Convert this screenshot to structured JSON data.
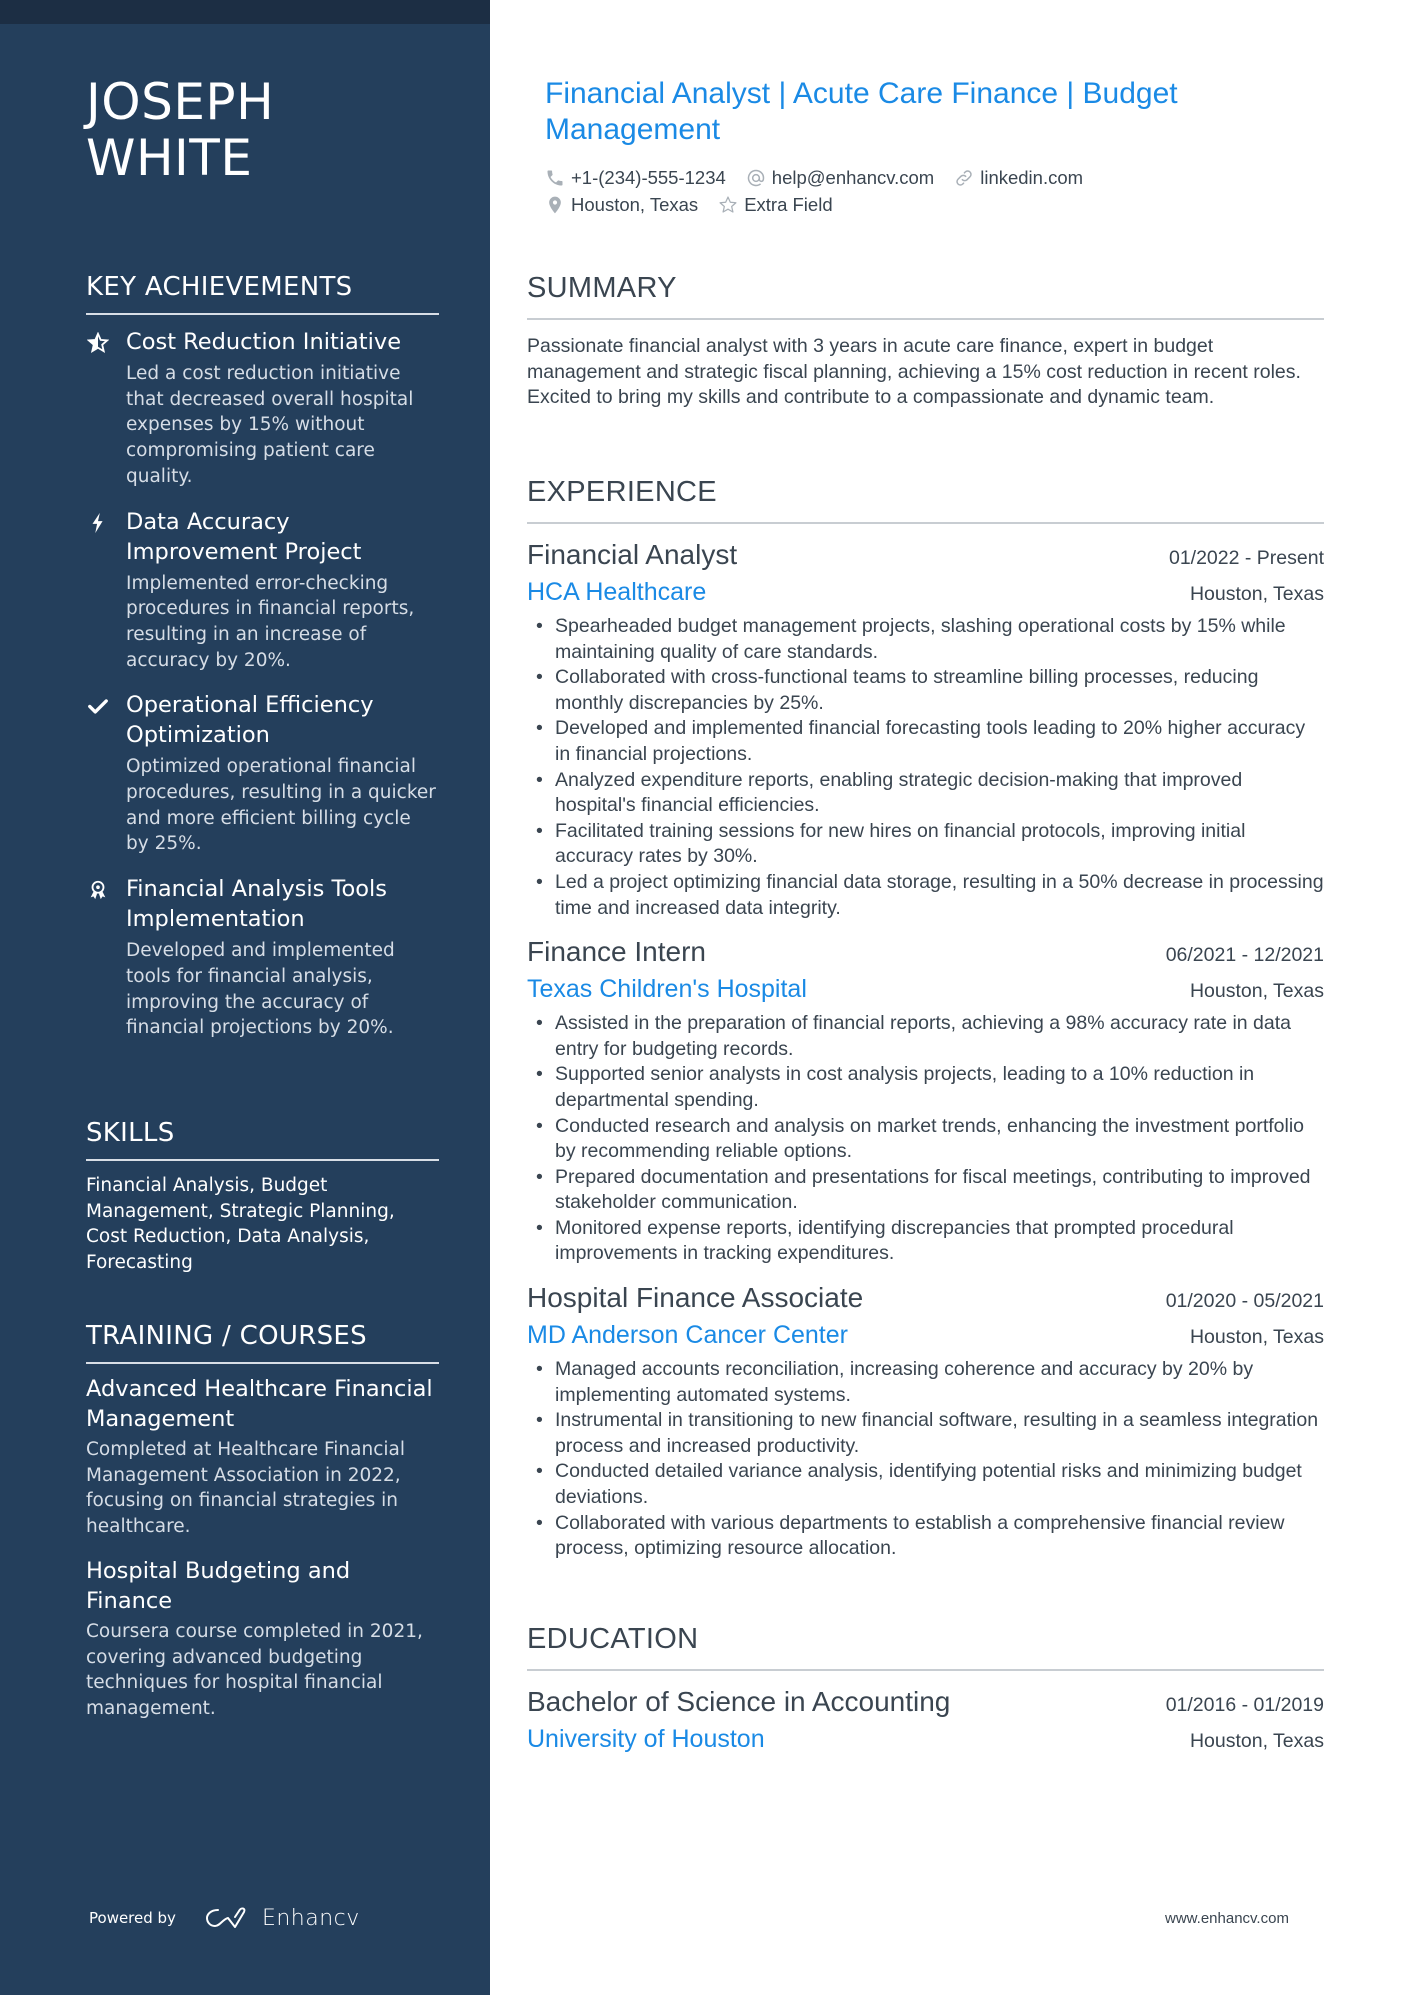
{
  "person": {
    "name": "JOSEPH WHITE",
    "headline": "Financial Analyst | Acute Care Finance | Budget Management",
    "contacts": [
      {
        "icon": "phone-icon",
        "value": "+1-(234)-555-1234"
      },
      {
        "icon": "at-icon",
        "value": "help@enhancv.com"
      },
      {
        "icon": "link-icon",
        "value": "linkedin.com"
      },
      {
        "icon": "location-pin-icon",
        "value": "Houston, Texas"
      },
      {
        "icon": "star-outline-icon",
        "value": "Extra Field"
      }
    ]
  },
  "sidebar": {
    "achievements": {
      "heading": "KEY ACHIEVEMENTS",
      "items": [
        {
          "icon": "star-icon",
          "title": "Cost Reduction Initiative",
          "description": "Led a cost reduction initiative that decreased overall hospital expenses by 15% without compromising patient care quality."
        },
        {
          "icon": "lightning-bolt-icon",
          "title": "Data Accuracy Improvement Project",
          "description": "Implemented error-checking procedures in financial reports, resulting in an increase of accuracy by 20%."
        },
        {
          "icon": "checkmark-icon",
          "title": "Operational Efficiency Optimization",
          "description": "Optimized operational financial procedures, resulting in a quicker and more efficient billing cycle by 25%."
        },
        {
          "icon": "award-ribbon-icon",
          "title": "Financial Analysis Tools Implementation",
          "description": "Developed and implemented tools for financial analysis, improving the accuracy of financial projections by 20%."
        }
      ]
    },
    "skills": {
      "heading": "SKILLS",
      "text": "Financial Analysis, Budget Management, Strategic Planning, Cost Reduction, Data Analysis, Forecasting"
    },
    "training": {
      "heading": "TRAINING / COURSES",
      "items": [
        {
          "title": "Advanced Healthcare Financial Management",
          "description": "Completed at Healthcare Financial Management Association in 2022, focusing on financial strategies in healthcare."
        },
        {
          "title": "Hospital Budgeting and Finance",
          "description": "Coursera course completed in 2021, covering advanced budgeting techniques for hospital financial management."
        }
      ]
    },
    "powered_by": {
      "label": "Powered by",
      "brand": "Enhancv"
    }
  },
  "summary": {
    "heading": "SUMMARY",
    "text": "Passionate financial analyst with 3 years in acute care finance, expert in budget management and strategic fiscal planning, achieving a 15% cost reduction in recent roles. Excited to bring my skills and contribute to a compassionate and dynamic team."
  },
  "experience": {
    "heading": "EXPERIENCE",
    "jobs": [
      {
        "title": "Financial Analyst",
        "dates": "01/2022 - Present",
        "company": "HCA Healthcare",
        "location": "Houston, Texas",
        "bullets": [
          "Spearheaded budget management projects, slashing operational costs by 15% while maintaining quality of care standards.",
          "Collaborated with cross-functional teams to streamline billing processes, reducing monthly discrepancies by 25%.",
          "Developed and implemented financial forecasting tools leading to 20% higher accuracy in financial projections.",
          "Analyzed expenditure reports, enabling strategic decision-making that improved hospital's financial efficiencies.",
          "Facilitated training sessions for new hires on financial protocols, improving initial accuracy rates by 30%.",
          "Led a project optimizing financial data storage, resulting in a 50% decrease in processing time and increased data integrity."
        ]
      },
      {
        "title": "Finance Intern",
        "dates": "06/2021 - 12/2021",
        "company": "Texas Children's Hospital",
        "location": "Houston, Texas",
        "bullets": [
          "Assisted in the preparation of financial reports, achieving a 98% accuracy rate in data entry for budgeting records.",
          "Supported senior analysts in cost analysis projects, leading to a 10% reduction in departmental spending.",
          "Conducted research and analysis on market trends, enhancing the investment portfolio by recommending reliable options.",
          "Prepared documentation and presentations for fiscal meetings, contributing to improved stakeholder communication.",
          "Monitored expense reports, identifying discrepancies that prompted procedural improvements in tracking expenditures."
        ]
      },
      {
        "title": "Hospital Finance Associate",
        "dates": "01/2020 - 05/2021",
        "company": "MD Anderson Cancer Center",
        "location": "Houston, Texas",
        "bullets": [
          "Managed accounts reconciliation, increasing coherence and accuracy by 20% by implementing automated systems.",
          "Instrumental in transitioning to new financial software, resulting in a seamless integration process and increased productivity.",
          "Conducted detailed variance analysis, identifying potential risks and minimizing budget deviations.",
          "Collaborated with various departments to establish a comprehensive financial review process, optimizing resource allocation."
        ]
      }
    ]
  },
  "education": {
    "heading": "EDUCATION",
    "items": [
      {
        "degree": "Bachelor of Science in Accounting",
        "dates": "01/2016 - 01/2019",
        "school": "University of Houston",
        "location": "Houston, Texas"
      }
    ]
  },
  "footer": {
    "url": "www.enhancv.com"
  },
  "colors": {
    "sidebar_bg": "#243f5c",
    "sidebar_top_strip": "#1c2e44",
    "accent_blue": "#1a8ae5",
    "body_text": "#3a4550"
  }
}
